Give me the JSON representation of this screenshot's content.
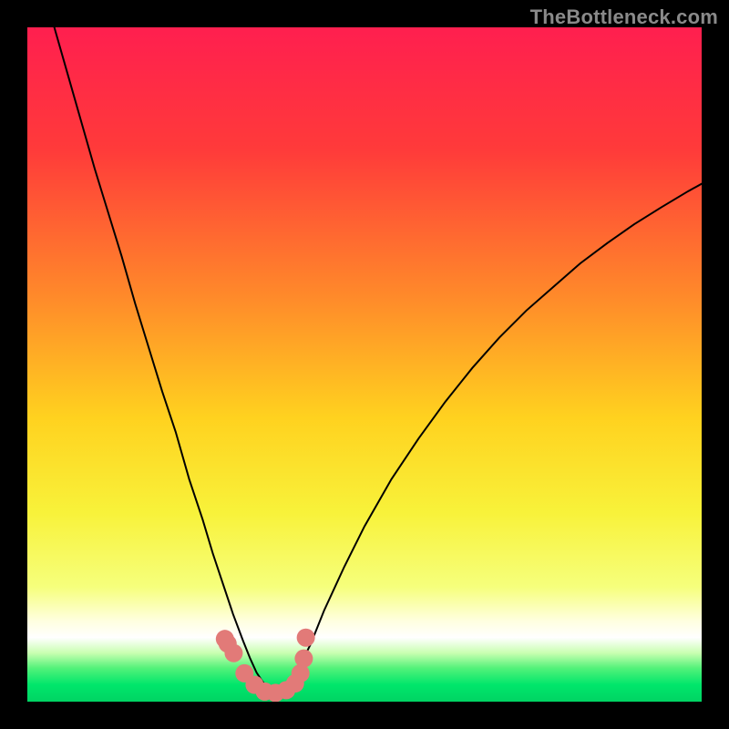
{
  "watermark": "TheBottleneck.com",
  "chart_data": {
    "type": "line",
    "title": "",
    "xlabel": "",
    "ylabel": "",
    "xlim": [
      0,
      100
    ],
    "ylim": [
      0,
      100
    ],
    "grid": false,
    "legend": false,
    "gradient_stops": [
      {
        "offset": 0.0,
        "color": "#ff1f4f"
      },
      {
        "offset": 0.18,
        "color": "#ff3a3a"
      },
      {
        "offset": 0.4,
        "color": "#ff8a2a"
      },
      {
        "offset": 0.58,
        "color": "#ffd21f"
      },
      {
        "offset": 0.72,
        "color": "#f8f23a"
      },
      {
        "offset": 0.83,
        "color": "#f6ff7c"
      },
      {
        "offset": 0.88,
        "color": "#ffffdf"
      },
      {
        "offset": 0.905,
        "color": "#ffffff"
      },
      {
        "offset": 0.928,
        "color": "#c8ffb0"
      },
      {
        "offset": 0.95,
        "color": "#54f27a"
      },
      {
        "offset": 0.975,
        "color": "#00e66b"
      },
      {
        "offset": 1.0,
        "color": "#00d463"
      }
    ],
    "series": [
      {
        "name": "left-curve",
        "stroke": "#000000",
        "stroke_width": 2,
        "x": [
          4,
          6,
          8,
          10,
          12,
          14,
          16,
          18,
          20,
          22,
          24,
          26,
          27.5,
          29,
          30.5,
          32,
          33,
          34,
          35,
          36,
          37
        ],
        "y": [
          100,
          93,
          86,
          79,
          72.5,
          66,
          59,
          52.5,
          46,
          40,
          33,
          27,
          22,
          17.5,
          13,
          9,
          6.5,
          4.3,
          2.8,
          1.6,
          1.2
        ]
      },
      {
        "name": "right-curve",
        "stroke": "#000000",
        "stroke_width": 2,
        "x": [
          37,
          38.5,
          40,
          42,
          44,
          47,
          50,
          54,
          58,
          62,
          66,
          70,
          74,
          78,
          82,
          86,
          90,
          94,
          98,
          100
        ],
        "y": [
          1.2,
          2.0,
          4.5,
          8.5,
          13.5,
          20,
          26,
          33,
          39,
          44.5,
          49.5,
          54,
          58,
          61.5,
          65,
          68,
          70.8,
          73.3,
          75.7,
          76.8
        ]
      },
      {
        "name": "highlight-dots",
        "type": "scatter",
        "color": "#e27a78",
        "radius_px": 10,
        "x": [
          29.3,
          29.7,
          30.6,
          32.2,
          33.7,
          35.2,
          36.8,
          38.4,
          39.7,
          40.5,
          41.0,
          41.3
        ],
        "y": [
          9.3,
          8.6,
          7.2,
          4.2,
          2.5,
          1.5,
          1.3,
          1.7,
          2.7,
          4.2,
          6.4,
          9.5
        ]
      }
    ]
  }
}
